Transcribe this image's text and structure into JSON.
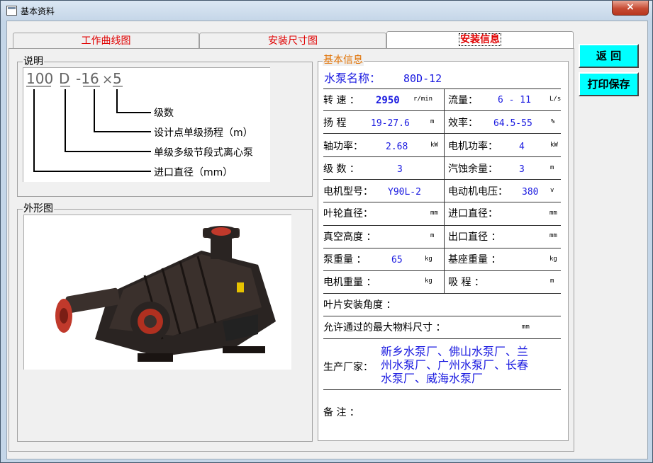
{
  "window": {
    "title": "基本资料",
    "close": "×"
  },
  "tabs": [
    "工作曲线图",
    "安装尺寸图",
    "安装信息"
  ],
  "buttons": {
    "back": "返  回",
    "print": "打印保存"
  },
  "desc": {
    "label": "说明",
    "code": {
      "a": "100",
      "b": "D",
      "c": "-16",
      "d": "×",
      "e": "5"
    },
    "lines": [
      "级数",
      "设计点单级扬程（m）",
      "单级多级节段式离心泵",
      "进口直径（mm）"
    ]
  },
  "shape": {
    "label": "外形图"
  },
  "info": {
    "label": "基本信息",
    "name_label": "水泵名称：",
    "name_value": "80D-12",
    "rows": [
      {
        "l1": "转  速 ：",
        "v1": "2950",
        "u1": "r/min",
        "l2": "流量：",
        "v2": "6 - 11",
        "u2": "L/s"
      },
      {
        "l1": "扬  程",
        "v1": "19-27.6",
        "u1": "m",
        "l2": "效率：",
        "v2": "64.5-55",
        "u2": "%"
      },
      {
        "l1": "轴功率：",
        "v1": "2.68",
        "u1": "kW",
        "l2": "电机功率：",
        "v2": "4",
        "u2": "kW"
      },
      {
        "l1": "级  数 ：",
        "v1": "3",
        "u1": "",
        "l2": "汽蚀余量：",
        "v2": "3",
        "u2": "m"
      },
      {
        "l1": "电机型号：",
        "v1": "Y90L-2",
        "u1": "",
        "l2": "电动机电压：",
        "v2": "380",
        "u2": "v"
      },
      {
        "l1": "叶轮直径：",
        "v1": "",
        "u1": "mm",
        "l2": "进口直径：",
        "v2": "",
        "u2": "mm"
      },
      {
        "l1": "真空高度 ：",
        "v1": "",
        "u1": "m",
        "l2": "出口直径 ：",
        "v2": "",
        "u2": "mm"
      },
      {
        "l1": "泵重量 ：",
        "v1": "65",
        "u1": "kg",
        "l2": "基座重量 ：",
        "v2": "",
        "u2": "kg"
      },
      {
        "l1": "电机重量 ：",
        "v1": "",
        "u1": "kg",
        "l2": "吸  程 ：",
        "v2": "",
        "u2": "m"
      }
    ],
    "blade_angle_label": "叶片安装角度 ：",
    "max_size_label": "允许通过的最大物料尺寸 ：",
    "max_size_unit": "mm",
    "maker_label": "生产厂家：",
    "maker_lines": [
      "新乡水泵厂、佛山水泵厂、兰",
      "州水泵厂、广州水泵厂、长春",
      "水泵厂、威海水泵厂"
    ],
    "remark_label": "备  注 ："
  },
  "colors": {
    "tab_text": "#e00000",
    "info_label": "#e07000",
    "value_blue": "#1a1ae0",
    "button_bg": "#00ffff",
    "close_red": "#c74c34"
  }
}
